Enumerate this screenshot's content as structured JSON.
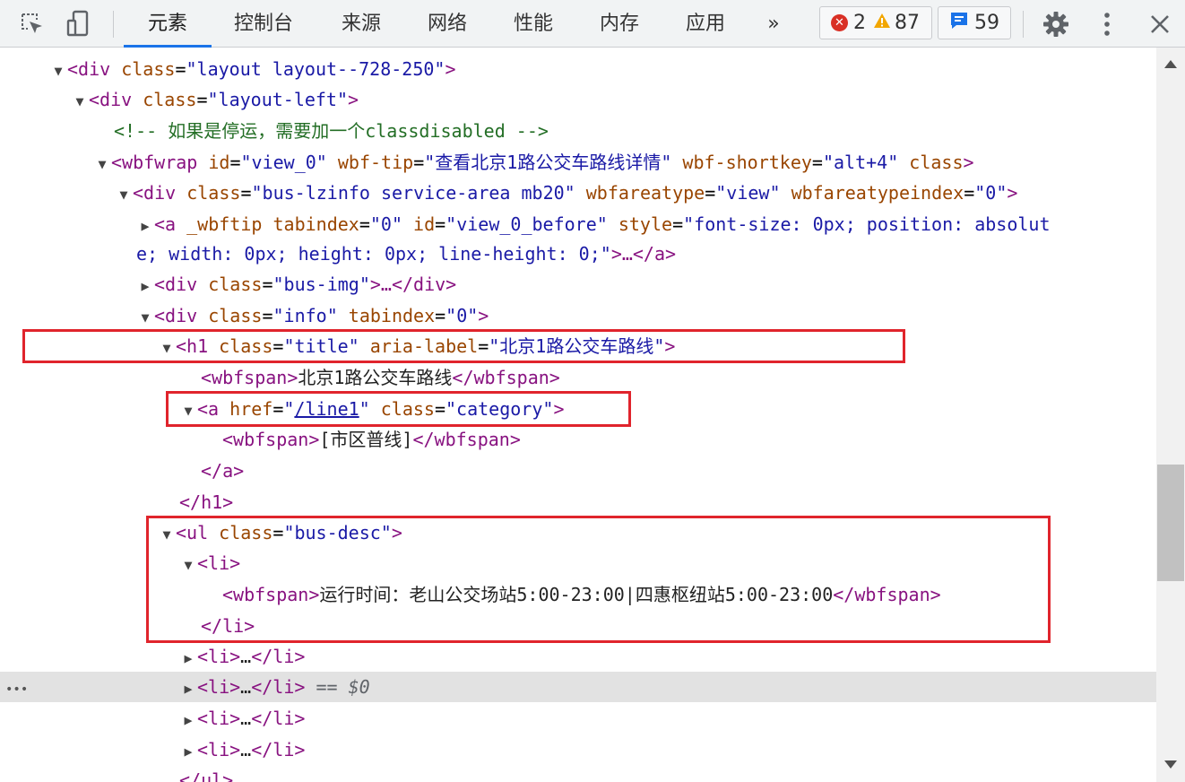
{
  "toolbar": {
    "tabs": [
      "元素",
      "控制台",
      "来源",
      "网络",
      "性能",
      "内存",
      "应用"
    ],
    "more": "»",
    "errors": "2",
    "warnings": "87",
    "messages": "59"
  },
  "code": {
    "l1": {
      "open": "<div",
      "a1": "class",
      "v1": "\"layout layout--728-250\"",
      "close": ">"
    },
    "l2": {
      "open": "<div",
      "a1": "class",
      "v1": "\"layout-left\"",
      "close": ">"
    },
    "l3": {
      "comment": "<!-- 如果是停运，需要加一个classdisabled -->"
    },
    "l4": {
      "open": "<wbfwrap",
      "a1": "id",
      "v1": "\"view_0\"",
      "a2": "wbf-tip",
      "v2": "\"查看北京1路公交车路线详情\"",
      "a3": "wbf-shortkey",
      "v3": "\"alt+4\"",
      "a4": "class",
      "close": ">"
    },
    "l5": {
      "open": "<div",
      "a1": "class",
      "v1": "\"bus-lzinfo service-area mb20\"",
      "a2": "wbfareatype",
      "v2": "\"view\"",
      "a3": "wbfareatypeindex",
      "v3": "\"0\"",
      "close": ">"
    },
    "l6": {
      "open": "<a",
      "a0": "_wbftip",
      "a1": "tabindex",
      "v1": "\"0\"",
      "a2": "id",
      "v2": "\"view_0_before\"",
      "a3": "style",
      "v3a": "\"font-size: 0px; position: absolut",
      "v3b": "e; width: 0px; height: 0px; line-height: 0;\"",
      "close": ">…</a>"
    },
    "l7": {
      "open": "<div",
      "a1": "class",
      "v1": "\"bus-img\"",
      "close": ">…</div>"
    },
    "l8": {
      "open": "<div",
      "a1": "class",
      "v1": "\"info\"",
      "a2": "tabindex",
      "v2": "\"0\"",
      "close": ">"
    },
    "l9": {
      "open": "<h1",
      "a1": "class",
      "v1": "\"title\"",
      "a2": "aria-label",
      "v2": "\"北京1路公交车路线\"",
      "close": ">"
    },
    "l10": {
      "open": "<wbfspan>",
      "text": "北京1路公交车路线",
      "close": "</wbfspan>"
    },
    "l11": {
      "open": "<a",
      "a1": "href",
      "q1": "\"",
      "link": "/line1",
      "q2": "\"",
      "a2": "class",
      "v2": "\"category\"",
      "close": ">"
    },
    "l12": {
      "open": "<wbfspan>",
      "text": "[市区普线]",
      "close": "</wbfspan>"
    },
    "l13": {
      "close": "</a>"
    },
    "l14": {
      "close": "</h1>"
    },
    "l15": {
      "open": "<ul",
      "a1": "class",
      "v1": "\"bus-desc\"",
      "close": ">"
    },
    "l16": {
      "open": "<li>"
    },
    "l17": {
      "open": "<wbfspan>",
      "text": "运行时间：老山公交场站5:00-23:00|四惠枢纽站5:00-23:00",
      "close": "</wbfspan>"
    },
    "l18": {
      "close": "</li>"
    },
    "l19": {
      "open": "<li>",
      "mid": "…",
      "close": "</li>"
    },
    "l20": {
      "open": "<li>",
      "mid": "…",
      "close": "</li>",
      "eq": "== $0",
      "dots": "•••"
    },
    "l21": {
      "open": "<li>",
      "mid": "…",
      "close": "</li>"
    },
    "l22": {
      "open": "<li>",
      "mid": "…",
      "close": "</li>"
    },
    "l23": {
      "close": "</ul>"
    }
  }
}
